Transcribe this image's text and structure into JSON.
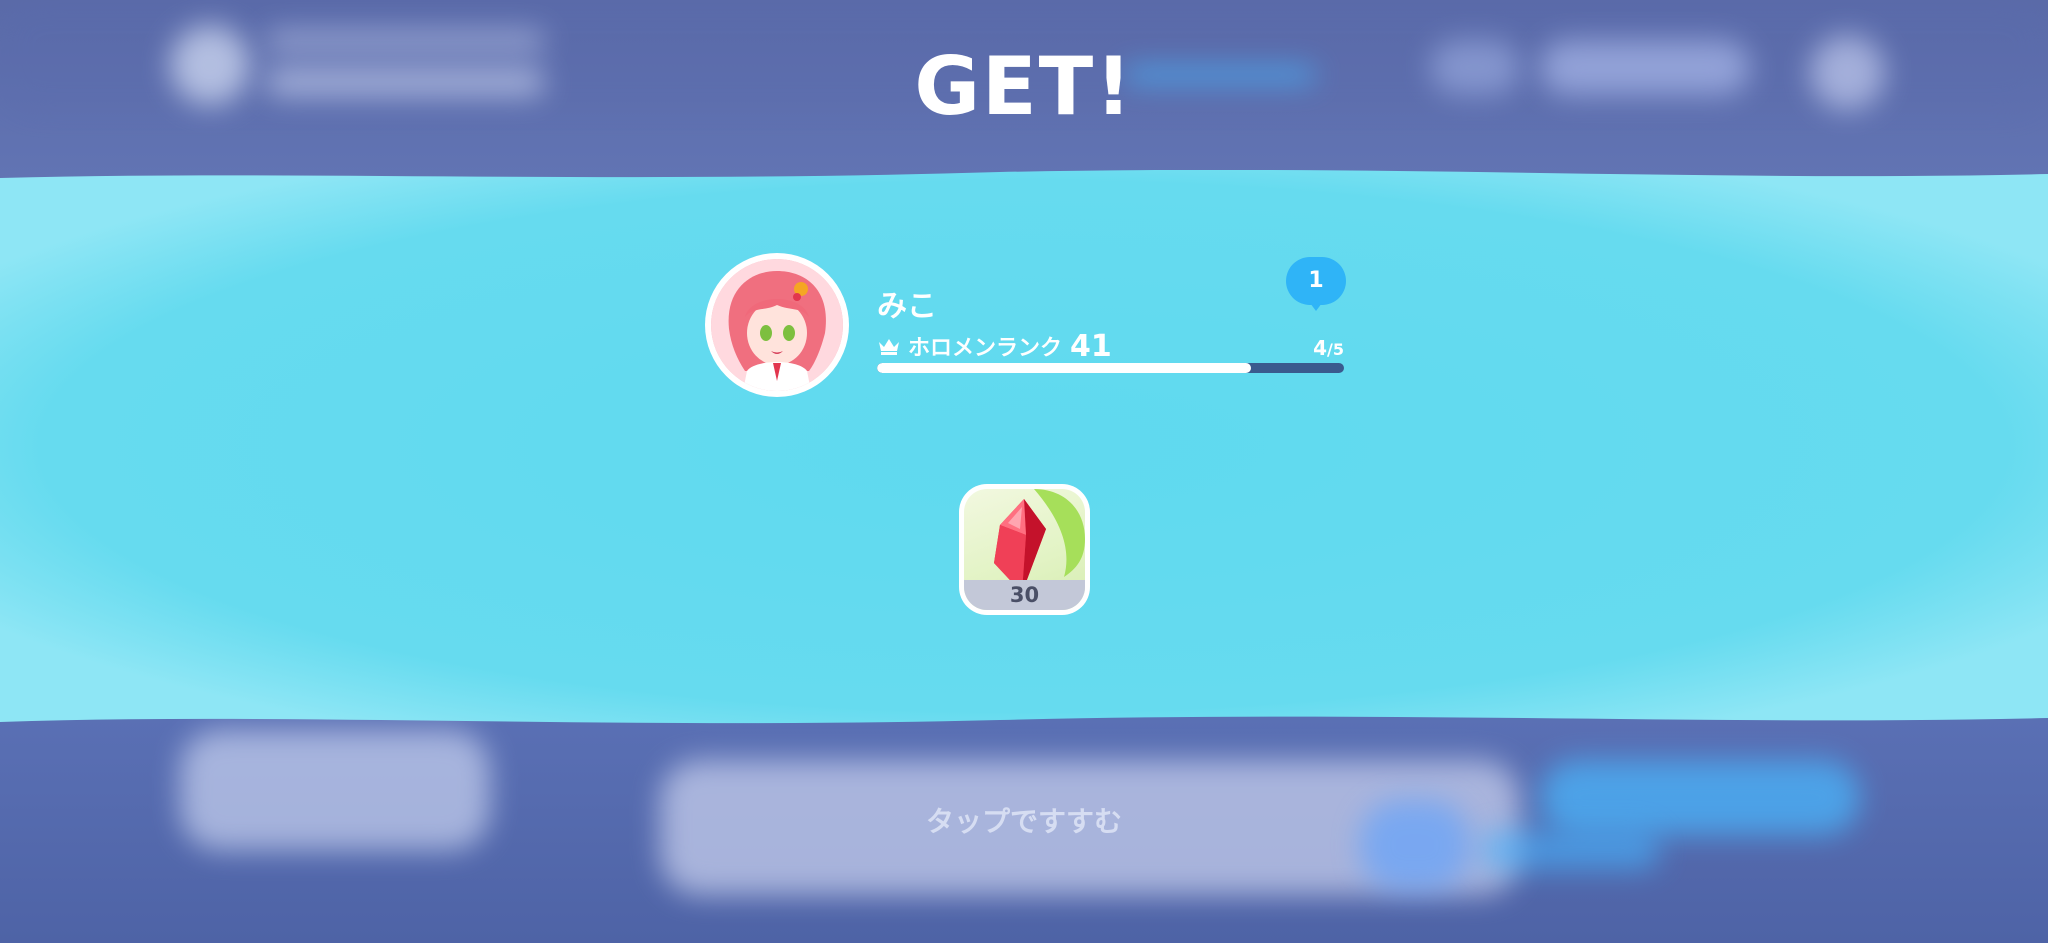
{
  "title": "GET!",
  "member": {
    "name": "みこ",
    "rank_label": "ホロメンランク",
    "rank_value": "41",
    "progress_current": "4",
    "progress_total": "/5",
    "progress_fraction": 0.8,
    "notification_count": "1"
  },
  "reward": {
    "icon": "red-crystal-icon",
    "count": "30"
  },
  "hint": "タップですすむ",
  "colors": {
    "banner": "#63d8ee",
    "banner_edge": "#8fe6f4",
    "accent_blue": "#2fb4f7",
    "progress_track": "#3a5a8e"
  }
}
